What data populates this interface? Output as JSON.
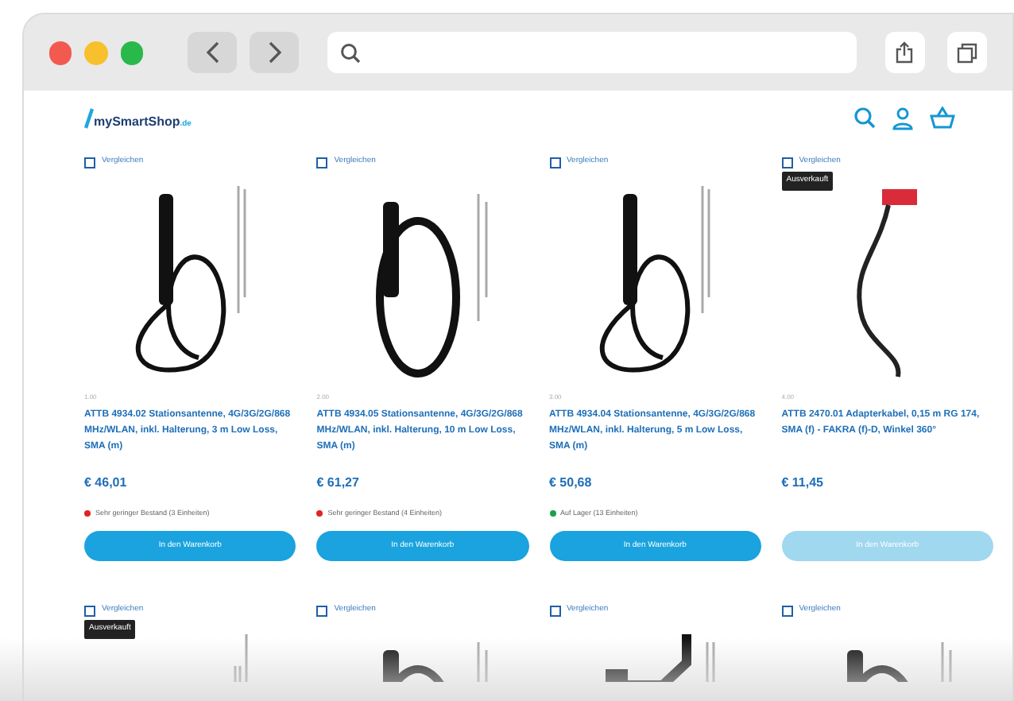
{
  "shop": {
    "logo": "mySmartShop",
    "logo_suffix": ".de"
  },
  "products": [
    {
      "compare": {
        "label": "Vergleichen",
        "checked": false
      },
      "sku": "1.00",
      "title": "ATTB 4934.02 Stationsantenne, 4G/3G/2G/868 MHz/WLAN, inkl. Halterung, 3 m Low Loss, SMA (m)",
      "price": "€ 46,01",
      "stock": {
        "text": "Sehr geringer Bestand (3 Einheiten)",
        "color": "#e02424"
      },
      "button": {
        "label": "In den Warenkorb",
        "disabled": false
      }
    },
    {
      "compare": {
        "label": "Vergleichen",
        "checked": false
      },
      "sku": "2.00",
      "title": "ATTB 4934.05 Stationsantenne, 4G/3G/2G/868 MHz/WLAN, inkl. Halterung, 10 m Low Loss, SMA (m)",
      "price": "€ 61,27",
      "stock": {
        "text": "Sehr geringer Bestand (4 Einheiten)",
        "color": "#e02424"
      },
      "button": {
        "label": "In den Warenkorb",
        "disabled": false
      }
    },
    {
      "compare": {
        "label": "Vergleichen",
        "checked": false
      },
      "sku": "3.00",
      "title": "ATTB 4934.04 Stationsantenne, 4G/3G/2G/868 MHz/WLAN, inkl. Halterung, 5 m Low Loss, SMA (m)",
      "price": "€ 50,68",
      "stock": {
        "text": "Auf Lager (13 Einheiten)",
        "color": "#16a34a"
      },
      "button": {
        "label": "In den Warenkorb",
        "disabled": false
      }
    },
    {
      "compare": {
        "label": "Vergleichen",
        "checked": false
      },
      "badge": "Ausverkauft",
      "sku": "4.00",
      "title": "ATTB 2470.01 Adapterkabel, 0,15 m RG 174, SMA (f) - FAKRA (f)-D, Winkel 360°",
      "price": "€ 11,45",
      "button": {
        "label": "In den Warenkorb",
        "disabled": true
      }
    }
  ],
  "more_products": [
    {
      "compare": {
        "label": "Vergleichen",
        "checked": false
      },
      "badge": "Ausverkauft"
    },
    {
      "compare": {
        "label": "Vergleichen",
        "checked": false
      }
    },
    {
      "compare": {
        "label": "Vergleichen",
        "checked": false
      }
    },
    {
      "compare": {
        "label": "Vergleichen",
        "checked": false
      }
    }
  ]
}
